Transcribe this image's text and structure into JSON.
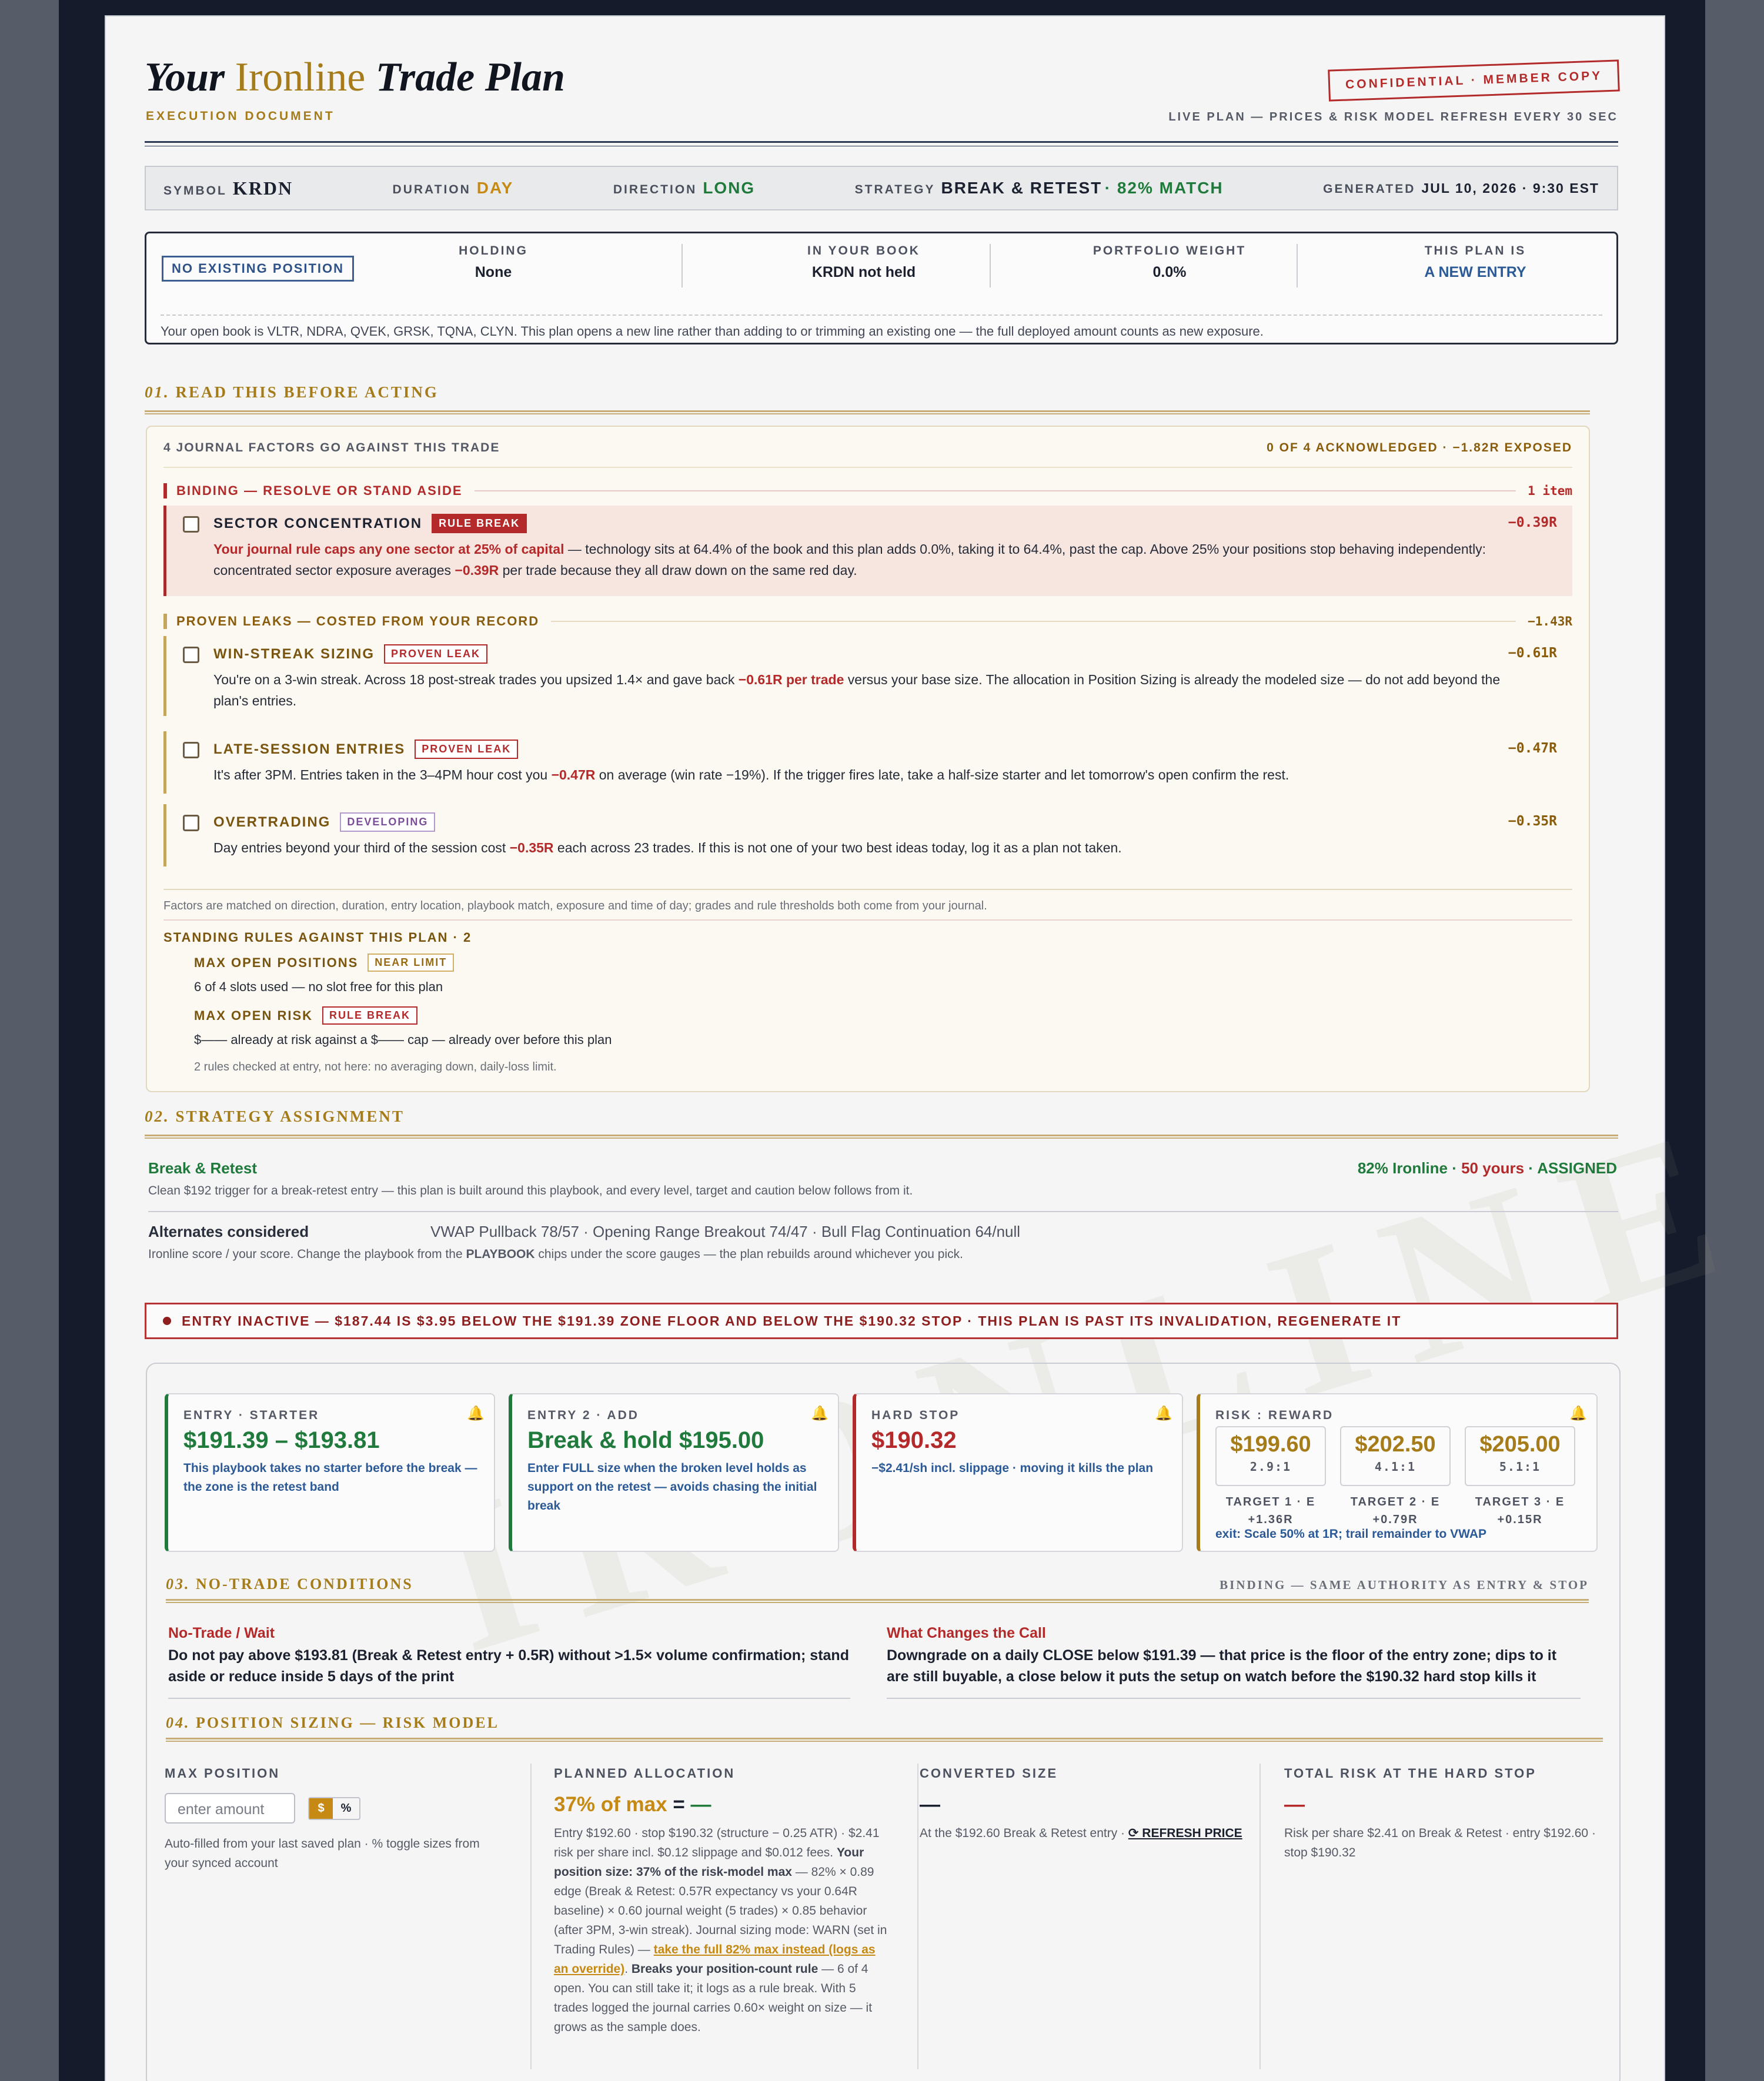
{
  "header": {
    "title_pre": "Your",
    "title_brand": "Ironline",
    "title_post": "Trade Plan",
    "subtitle": "EXECUTION DOCUMENT",
    "stamp": "CONFIDENTIAL · MEMBER COPY",
    "live_note": "LIVE PLAN — PRICES & RISK MODEL REFRESH EVERY 30 SEC"
  },
  "meta": {
    "symbol_k": "SYMBOL",
    "symbol_v": "KRDN",
    "duration_k": "DURATION",
    "duration_v": "DAY",
    "direction_k": "DIRECTION",
    "direction_v": "LONG",
    "strategy_k": "STRATEGY",
    "strategy_v": "BREAK & RETEST",
    "strategy_match": "· 82% MATCH",
    "generated_k": "GENERATED",
    "generated_v": "JUL 10, 2026 · 9:30 EST"
  },
  "position": {
    "badge": "NO EXISTING POSITION",
    "holding_k": "HOLDING",
    "holding_v": "None",
    "book_k": "IN YOUR BOOK",
    "book_v": "KRDN not held",
    "weight_k": "PORTFOLIO WEIGHT",
    "weight_v": "0.0%",
    "plan_k": "THIS PLAN IS",
    "plan_v": "A NEW ENTRY",
    "note": "Your open book is VLTR, NDRA, QVEK, GRSK, TQNA, CLYN. This plan opens a new line rather than adding to or trimming an existing one — the full deployed amount counts as new exposure."
  },
  "section1": {
    "num": "01.",
    "title": "READ THIS BEFORE ACTING",
    "head_left": "4 JOURNAL FACTORS GO AGAINST THIS TRADE",
    "head_right": "0 OF 4 ACKNOWLEDGED · −1.82R EXPOSED",
    "binding": {
      "label": "BINDING — RESOLVE OR STAND ASIDE",
      "count": "1 item"
    },
    "leaks": {
      "label": "PROVEN LEAKS — COSTED FROM YOUR RECORD",
      "count": "−1.43R"
    },
    "items": [
      {
        "name": "SECTOR CONCENTRATION",
        "tag": "RULE BREAK",
        "cost": "−0.39R",
        "d1": "Your journal rule caps any one sector at 25% of capital",
        "d2": " — technology sits at 64.4% of the book and this plan adds 0.0%, taking it to 64.4%, past the cap. Above 25% your positions stop behaving independently: concentrated sector exposure averages ",
        "d3": "−0.39R",
        "d4": " per trade because they all draw down on the same red day."
      },
      {
        "name": "WIN-STREAK SIZING",
        "tag": "PROVEN LEAK",
        "cost": "−0.61R",
        "d1": "You're on a 3-win streak. Across 18 post-streak trades you upsized 1.4× and gave back ",
        "d2": "−0.61R per trade",
        "d3": " versus your base size. The allocation in Position Sizing is already the modeled size — do not add beyond the plan's entries."
      },
      {
        "name": "LATE-SESSION ENTRIES",
        "tag": "PROVEN LEAK",
        "cost": "−0.47R",
        "d1": "It's after 3PM. Entries taken in the 3–4PM hour cost you ",
        "d2": "−0.47R",
        "d3": " on average (win rate −19%). If the trigger fires late, take a half-size starter and let tomorrow's open confirm the rest."
      },
      {
        "name": "OVERTRADING",
        "tag": "DEVELOPING",
        "cost": "−0.35R",
        "d1": "Day entries beyond your third of the session cost ",
        "d2": "−0.35R",
        "d3": " each across 23 trades. If this is not one of your two best ideas today, log it as a plan not taken."
      }
    ],
    "footnote": "Factors are matched on direction, duration, entry location, playbook match, exposure and time of day; grades and rule thresholds both come from your journal.",
    "rules_h": "STANDING RULES AGAINST THIS PLAN · 2",
    "rules": [
      {
        "name": "MAX OPEN POSITIONS",
        "tag": "NEAR LIMIT",
        "desc": "6 of 4 slots used — no slot free for this plan"
      },
      {
        "name": "MAX OPEN RISK",
        "tag": "RULE BREAK",
        "desc": "$—— already at risk against a $—— cap — already over before this plan"
      }
    ],
    "rules_foot": "2 rules checked at entry, not here: no averaging down, daily-loss limit."
  },
  "section2": {
    "num": "02.",
    "title": "STRATEGY ASSIGNMENT",
    "name": "Break & Retest",
    "desc": "Clean $192 trigger for a break-retest entry — this plan is built around this playbook, and every level, target and caution below follows from it.",
    "score_a": "82% Ironline",
    "score_b": " · ",
    "score_c": "50 yours",
    "score_d": " · ASSIGNED",
    "alt_h": "Alternates considered",
    "alt_v": "VWAP Pullback 78/57 · Opening Range Breakout 74/47 · Bull Flag Continuation 64/null",
    "alt_desc_a": "Ironline score / your score. Change the playbook from the ",
    "alt_desc_b": "PLAYBOOK",
    "alt_desc_c": " chips under the score gauges — the plan rebuilds around whichever you pick."
  },
  "alert": "ENTRY INACTIVE — $187.44 IS $3.95 BELOW THE $191.39 ZONE FLOOR AND BELOW THE $190.32 STOP · THIS PLAN IS PAST ITS INVALIDATION, REGENERATE IT",
  "cards": {
    "entry1": {
      "k": "ENTRY · STARTER",
      "big": "$191.39 – $193.81",
      "sub": "This playbook takes no starter before the break — the zone is the retest band"
    },
    "entry2": {
      "k": "ENTRY 2 · ADD",
      "big": "Break & hold $195.00",
      "sub": "Enter FULL size when the broken level holds as support on the retest — avoids chasing the initial break"
    },
    "stop": {
      "k": "HARD STOP",
      "big": "$190.32",
      "sub": "−$2.41/sh incl. slippage · moving it kills the plan"
    },
    "rr": {
      "k": "RISK : REWARD",
      "targets": [
        {
          "p": "$199.60",
          "rr": "2.9:1",
          "l1": "TARGET 1 · E",
          "l2": "+1.36R"
        },
        {
          "p": "$202.50",
          "rr": "4.1:1",
          "l1": "TARGET 2 · E",
          "l2": "+0.79R"
        },
        {
          "p": "$205.00",
          "rr": "5.1:1",
          "l1": "TARGET 3 · E",
          "l2": "+0.15R"
        }
      ],
      "exit": "exit: Scale 50% at 1R; trail remainder to VWAP"
    }
  },
  "section3": {
    "num": "03.",
    "title": "NO-TRADE CONDITIONS",
    "right": "BINDING — SAME AUTHORITY AS ENTRY & STOP",
    "left_h": "No-Trade / Wait",
    "left_t": "Do not pay above $193.81 (Break & Retest entry + 0.5R) without >1.5× volume confirmation; stand aside or reduce inside 5 days of the print",
    "right_h": "What Changes the Call",
    "right_t": "Downgrade on a daily CLOSE below $191.39 — that price is the floor of the entry zone; dips to it are still buyable, a close below it puts the setup on watch before the $190.32 hard stop kills it"
  },
  "section4": {
    "num": "04.",
    "title": "POSITION SIZING — RISK MODEL",
    "max_k": "MAX POSITION",
    "max_placeholder": "enter amount",
    "tog_a": "$",
    "tog_b": "%",
    "max_note": "Auto-filled from your last saved plan · % toggle sizes from your synced account",
    "alloc_k": "PLANNED ALLOCATION",
    "alloc_v": "37% of max",
    "alloc_eq": " = ",
    "alloc_dash": "—",
    "alloc_t1": "Entry $192.60 · stop $190.32 (structure − 0.25 ATR) · $2.41 risk per share incl. $0.12 slippage and $0.012 fees. ",
    "alloc_t2": "Your position size: 37% of the risk-model max",
    "alloc_t3": " — 82% × 0.89 edge (Break & Retest: 0.57R expectancy vs your 0.64R baseline) × 0.60 journal weight (5 trades) × 0.85 behavior (after 3PM, 3-win streak). Journal sizing mode: WARN (set in Trading Rules) — ",
    "alloc_link": "take the full 82% max instead (logs as an override)",
    "alloc_t4": ". ",
    "alloc_t5": "Breaks your position-count rule",
    "alloc_t6": " — 6 of 4 open. You can still take it; it logs as a rule break. With 5 trades logged the journal carries 0.60× weight on size — it grows as the sample does.",
    "conv_k": "CONVERTED SIZE",
    "conv_v": "—",
    "conv_t": "At the $192.60 Break & Retest entry · ",
    "conv_link": "⟳ REFRESH PRICE",
    "risk_k": "TOTAL RISK AT THE HARD STOP",
    "risk_v": "—",
    "risk_t": "Risk per share $2.41 on Break & Retest · entry $192.60 · stop $190.32"
  },
  "watermark": "IRONLINE",
  "colors": {
    "gold": "#a67c1a",
    "green": "#1f7a3c",
    "red": "#b42a2a",
    "navy": "#2c5a96"
  }
}
